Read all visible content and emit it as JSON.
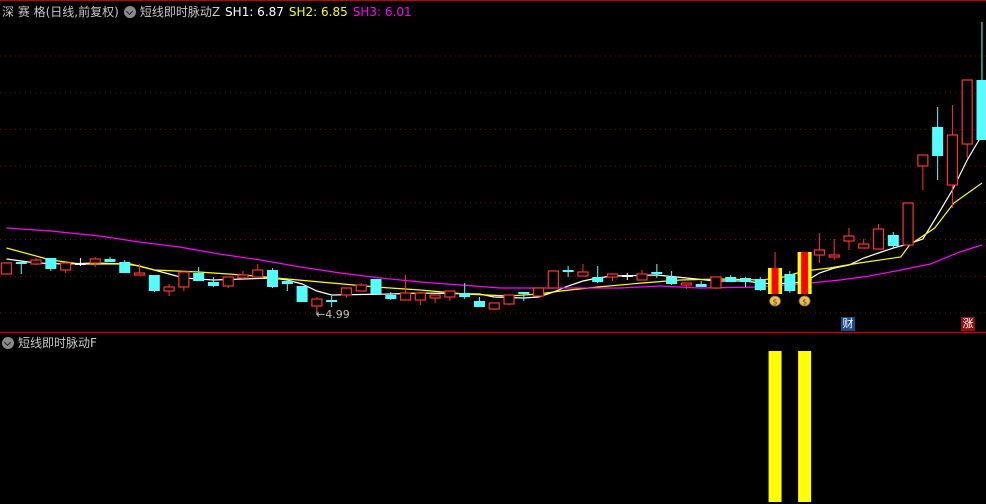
{
  "header": {
    "security": "深 赛 格(日线,前复权)",
    "indicator_name": "短线即时脉动Z",
    "sh1": "SH1: 6.87",
    "sh2": "SH2: 6.85",
    "sh3": "SH3: 6.01"
  },
  "sub_panel": {
    "indicator_name": "短线即时脉动F"
  },
  "annotations": {
    "low_label": "←4.99",
    "badge_cai": "财",
    "badge_zhang": "涨"
  },
  "colors": {
    "up": "#ff3232",
    "down": "#54ffff",
    "doji": "#ffffff",
    "sh1": "#ffffff",
    "sh2": "#ffff00",
    "sh3": "#ff00ff",
    "signal": "#ffff00",
    "grid": "#8b0000",
    "border": "#c00000"
  },
  "chart_data": {
    "type": "candlestick",
    "ohlc": [
      [
        5.36,
        5.48,
        5.36,
        5.47
      ],
      [
        5.47,
        5.49,
        5.36,
        5.46
      ],
      [
        5.46,
        5.52,
        5.45,
        5.5
      ],
      [
        5.52,
        5.52,
        5.39,
        5.41
      ],
      [
        5.4,
        5.48,
        5.37,
        5.47
      ],
      [
        5.46,
        5.52,
        5.44,
        5.46
      ],
      [
        5.47,
        5.53,
        5.43,
        5.51
      ],
      [
        5.51,
        5.53,
        5.48,
        5.48
      ],
      [
        5.48,
        5.5,
        5.37,
        5.37
      ],
      [
        5.35,
        5.46,
        5.35,
        5.37
      ],
      [
        5.35,
        5.35,
        5.18,
        5.19
      ],
      [
        5.19,
        5.26,
        5.14,
        5.23
      ],
      [
        5.23,
        5.38,
        5.19,
        5.38
      ],
      [
        5.37,
        5.43,
        5.29,
        5.29
      ],
      [
        5.28,
        5.33,
        5.23,
        5.24
      ],
      [
        5.24,
        5.33,
        5.22,
        5.33
      ],
      [
        5.32,
        5.39,
        5.31,
        5.35
      ],
      [
        5.33,
        5.46,
        5.33,
        5.4
      ],
      [
        5.4,
        5.42,
        5.22,
        5.23
      ],
      [
        5.29,
        5.29,
        5.19,
        5.26
      ],
      [
        5.24,
        5.24,
        5.08,
        5.08
      ],
      [
        5.04,
        5.13,
        4.99,
        5.11
      ],
      [
        5.1,
        5.14,
        5.03,
        5.08
      ],
      [
        5.15,
        5.22,
        5.12,
        5.22
      ],
      [
        5.19,
        5.27,
        5.19,
        5.25
      ],
      [
        5.31,
        5.31,
        5.16,
        5.16
      ],
      [
        5.15,
        5.18,
        5.1,
        5.11
      ],
      [
        5.1,
        5.35,
        5.1,
        5.17
      ],
      [
        5.1,
        5.18,
        5.05,
        5.17
      ],
      [
        5.12,
        5.15,
        5.07,
        5.15
      ],
      [
        5.13,
        5.19,
        5.09,
        5.19
      ],
      [
        5.17,
        5.27,
        5.11,
        5.13
      ],
      [
        5.09,
        5.13,
        5.03,
        5.03
      ],
      [
        5.01,
        5.07,
        5.0,
        5.07
      ],
      [
        5.06,
        5.15,
        5.05,
        5.15
      ],
      [
        5.18,
        5.18,
        5.09,
        5.16
      ],
      [
        5.14,
        5.22,
        5.14,
        5.22
      ],
      [
        5.22,
        5.39,
        5.22,
        5.39
      ],
      [
        5.39,
        5.44,
        5.33,
        5.38
      ],
      [
        5.34,
        5.46,
        5.34,
        5.38
      ],
      [
        5.33,
        5.44,
        5.27,
        5.28
      ],
      [
        5.33,
        5.36,
        5.29,
        5.36
      ],
      [
        5.34,
        5.37,
        5.3,
        5.34
      ],
      [
        5.3,
        5.4,
        5.3,
        5.36
      ],
      [
        5.37,
        5.46,
        5.32,
        5.36
      ],
      [
        5.33,
        5.39,
        5.25,
        5.26
      ],
      [
        5.25,
        5.27,
        5.21,
        5.27
      ],
      [
        5.26,
        5.29,
        5.23,
        5.23
      ],
      [
        5.22,
        5.33,
        5.21,
        5.33
      ],
      [
        5.33,
        5.35,
        5.28,
        5.28
      ],
      [
        5.32,
        5.33,
        5.23,
        5.28
      ],
      [
        5.31,
        5.33,
        5.19,
        5.2
      ],
      [
        5.16,
        5.58,
        5.16,
        5.42
      ],
      [
        5.36,
        5.39,
        5.17,
        5.19
      ],
      [
        5.16,
        5.58,
        5.16,
        5.58
      ],
      [
        5.55,
        5.77,
        5.47,
        5.6
      ],
      [
        5.53,
        5.71,
        5.5,
        5.55
      ],
      [
        5.69,
        5.82,
        5.6,
        5.74
      ],
      [
        5.62,
        5.71,
        5.62,
        5.66
      ],
      [
        5.61,
        5.86,
        5.61,
        5.81
      ],
      [
        5.75,
        5.78,
        5.62,
        5.64
      ],
      [
        5.65,
        6.07,
        5.65,
        6.07
      ],
      [
        6.44,
        6.55,
        6.2,
        6.55
      ],
      [
        6.83,
        7.03,
        6.3,
        6.54
      ],
      [
        6.25,
        7.05,
        6.02,
        6.75
      ],
      [
        6.66,
        7.3,
        6.52,
        7.3
      ],
      [
        7.3,
        7.88,
        6.7,
        6.7
      ]
    ],
    "ohlc_order": [
      "open",
      "high",
      "low",
      "close"
    ],
    "signal_bars": [
      52,
      54
    ],
    "money_bag_markers": [
      52,
      54
    ],
    "lowest_label": {
      "index": 21,
      "value": 4.99
    },
    "series": [
      {
        "name": "SH1",
        "color": "#ffffff",
        "points": [
          [
            0,
            5.51
          ],
          [
            2,
            5.47
          ],
          [
            4,
            5.46
          ],
          [
            6,
            5.47
          ],
          [
            8,
            5.46
          ],
          [
            9,
            5.44
          ],
          [
            10,
            5.4
          ],
          [
            11,
            5.36
          ],
          [
            12,
            5.32
          ],
          [
            14,
            5.3
          ],
          [
            16,
            5.31
          ],
          [
            18,
            5.32
          ],
          [
            19,
            5.3
          ],
          [
            20,
            5.26
          ],
          [
            21,
            5.19
          ],
          [
            22,
            5.15
          ],
          [
            26,
            5.16
          ],
          [
            28,
            5.17
          ],
          [
            32,
            5.16
          ],
          [
            33,
            5.13
          ],
          [
            35,
            5.12
          ],
          [
            36,
            5.13
          ],
          [
            37,
            5.18
          ],
          [
            38,
            5.24
          ],
          [
            39,
            5.29
          ],
          [
            40,
            5.32
          ],
          [
            41,
            5.34
          ],
          [
            44,
            5.35
          ],
          [
            46,
            5.32
          ],
          [
            48,
            5.29
          ],
          [
            50,
            5.29
          ],
          [
            51,
            5.27
          ],
          [
            52,
            5.26
          ],
          [
            54,
            5.28
          ],
          [
            55,
            5.37
          ],
          [
            56,
            5.42
          ],
          [
            57,
            5.45
          ],
          [
            58,
            5.52
          ],
          [
            59,
            5.57
          ],
          [
            60,
            5.62
          ],
          [
            61,
            5.66
          ],
          [
            62,
            5.71
          ],
          [
            63,
            5.95
          ],
          [
            64,
            6.2
          ],
          [
            65,
            6.5
          ],
          [
            66,
            6.75
          ]
        ]
      },
      {
        "name": "SH2",
        "color": "#ffff00",
        "points": [
          [
            0,
            5.62
          ],
          [
            3,
            5.5
          ],
          [
            5,
            5.46
          ],
          [
            8.4,
            5.46
          ],
          [
            10,
            5.4
          ],
          [
            13,
            5.38
          ],
          [
            16,
            5.35
          ],
          [
            19,
            5.31
          ],
          [
            22,
            5.27
          ],
          [
            25,
            5.23
          ],
          [
            28,
            5.2
          ],
          [
            31,
            5.16
          ],
          [
            34,
            5.14
          ],
          [
            36,
            5.16
          ],
          [
            37.5,
            5.19
          ],
          [
            40,
            5.23
          ],
          [
            43,
            5.27
          ],
          [
            45.6,
            5.3
          ],
          [
            48.3,
            5.31
          ],
          [
            51,
            5.3
          ],
          [
            52.3,
            5.32
          ],
          [
            54,
            5.39
          ],
          [
            55.7,
            5.42
          ],
          [
            57.7,
            5.47
          ],
          [
            60.5,
            5.53
          ],
          [
            61.1,
            5.65
          ],
          [
            62.8,
            5.82
          ],
          [
            64.1,
            6.07
          ],
          [
            66,
            6.27
          ]
        ]
      },
      {
        "name": "SH3",
        "color": "#ff00ff",
        "points": [
          [
            0,
            5.82
          ],
          [
            3,
            5.79
          ],
          [
            6.3,
            5.74
          ],
          [
            9,
            5.68
          ],
          [
            11.7,
            5.63
          ],
          [
            14.4,
            5.56
          ],
          [
            17.2,
            5.5
          ],
          [
            19.9,
            5.43
          ],
          [
            22.6,
            5.37
          ],
          [
            25.3,
            5.32
          ],
          [
            28,
            5.28
          ],
          [
            30.7,
            5.25
          ],
          [
            33.4,
            5.22
          ],
          [
            37.5,
            5.22
          ],
          [
            41.5,
            5.22
          ],
          [
            44.2,
            5.24
          ],
          [
            46.9,
            5.22
          ],
          [
            51,
            5.23
          ],
          [
            53.7,
            5.26
          ],
          [
            56.4,
            5.3
          ],
          [
            58.4,
            5.34
          ],
          [
            60.5,
            5.4
          ],
          [
            62.5,
            5.46
          ],
          [
            64.5,
            5.58
          ],
          [
            66,
            5.65
          ]
        ]
      }
    ],
    "sub_chart": {
      "type": "bar",
      "indices": [
        52,
        54
      ],
      "values": [
        1,
        1
      ],
      "color": "#ffff00"
    },
    "grid": true
  }
}
